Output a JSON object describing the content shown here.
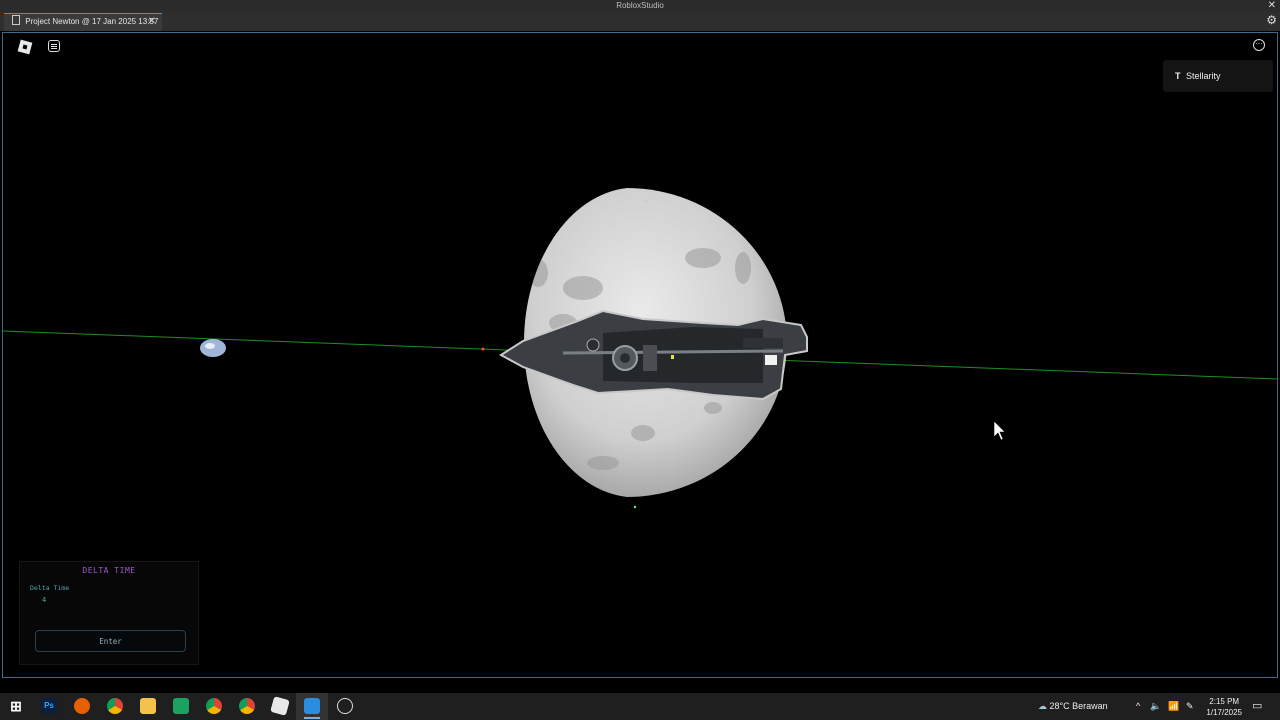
{
  "window": {
    "title": "RobloxStudio",
    "close_glyph": "✕"
  },
  "tab": {
    "label": "Project Newton @ 17 Jan 2025 13:57",
    "close_glyph": "✕",
    "icon": "document-icon"
  },
  "viewport": {
    "player_badge": {
      "icon": "team-icon",
      "icon_glyph": "T",
      "name": "Stellarity"
    },
    "menu_glyph": "···",
    "scene": {
      "moon_color": "#cfcfcf",
      "orbit_line_color": "#1f8f1f",
      "earth_color": "#9fb6d8"
    }
  },
  "delta_panel": {
    "title": "DELTA TIME",
    "label": "Delta Time",
    "value": "4",
    "button": "Enter",
    "title_color": "#9b59d0",
    "text_color": "#4ea6b0"
  },
  "taskbar": {
    "apps": [
      {
        "name": "windows-start-icon",
        "glyph": "⊞"
      },
      {
        "name": "photoshop-icon",
        "glyph": "Ps"
      },
      {
        "name": "firefox-icon",
        "glyph": ""
      },
      {
        "name": "chrome-icon",
        "glyph": ""
      },
      {
        "name": "file-explorer-icon",
        "glyph": ""
      },
      {
        "name": "app-green-icon",
        "glyph": ""
      },
      {
        "name": "chrome-profile-icon",
        "glyph": ""
      },
      {
        "name": "chrome-profile-2-icon",
        "glyph": ""
      },
      {
        "name": "roblox-player-icon",
        "glyph": ""
      },
      {
        "name": "roblox-studio-icon",
        "glyph": ""
      },
      {
        "name": "clock-app-icon",
        "glyph": ""
      }
    ],
    "weather": {
      "temp": "28°C",
      "condition": "Berawan"
    },
    "time": "2:15 PM",
    "date": "1/17/2025"
  }
}
